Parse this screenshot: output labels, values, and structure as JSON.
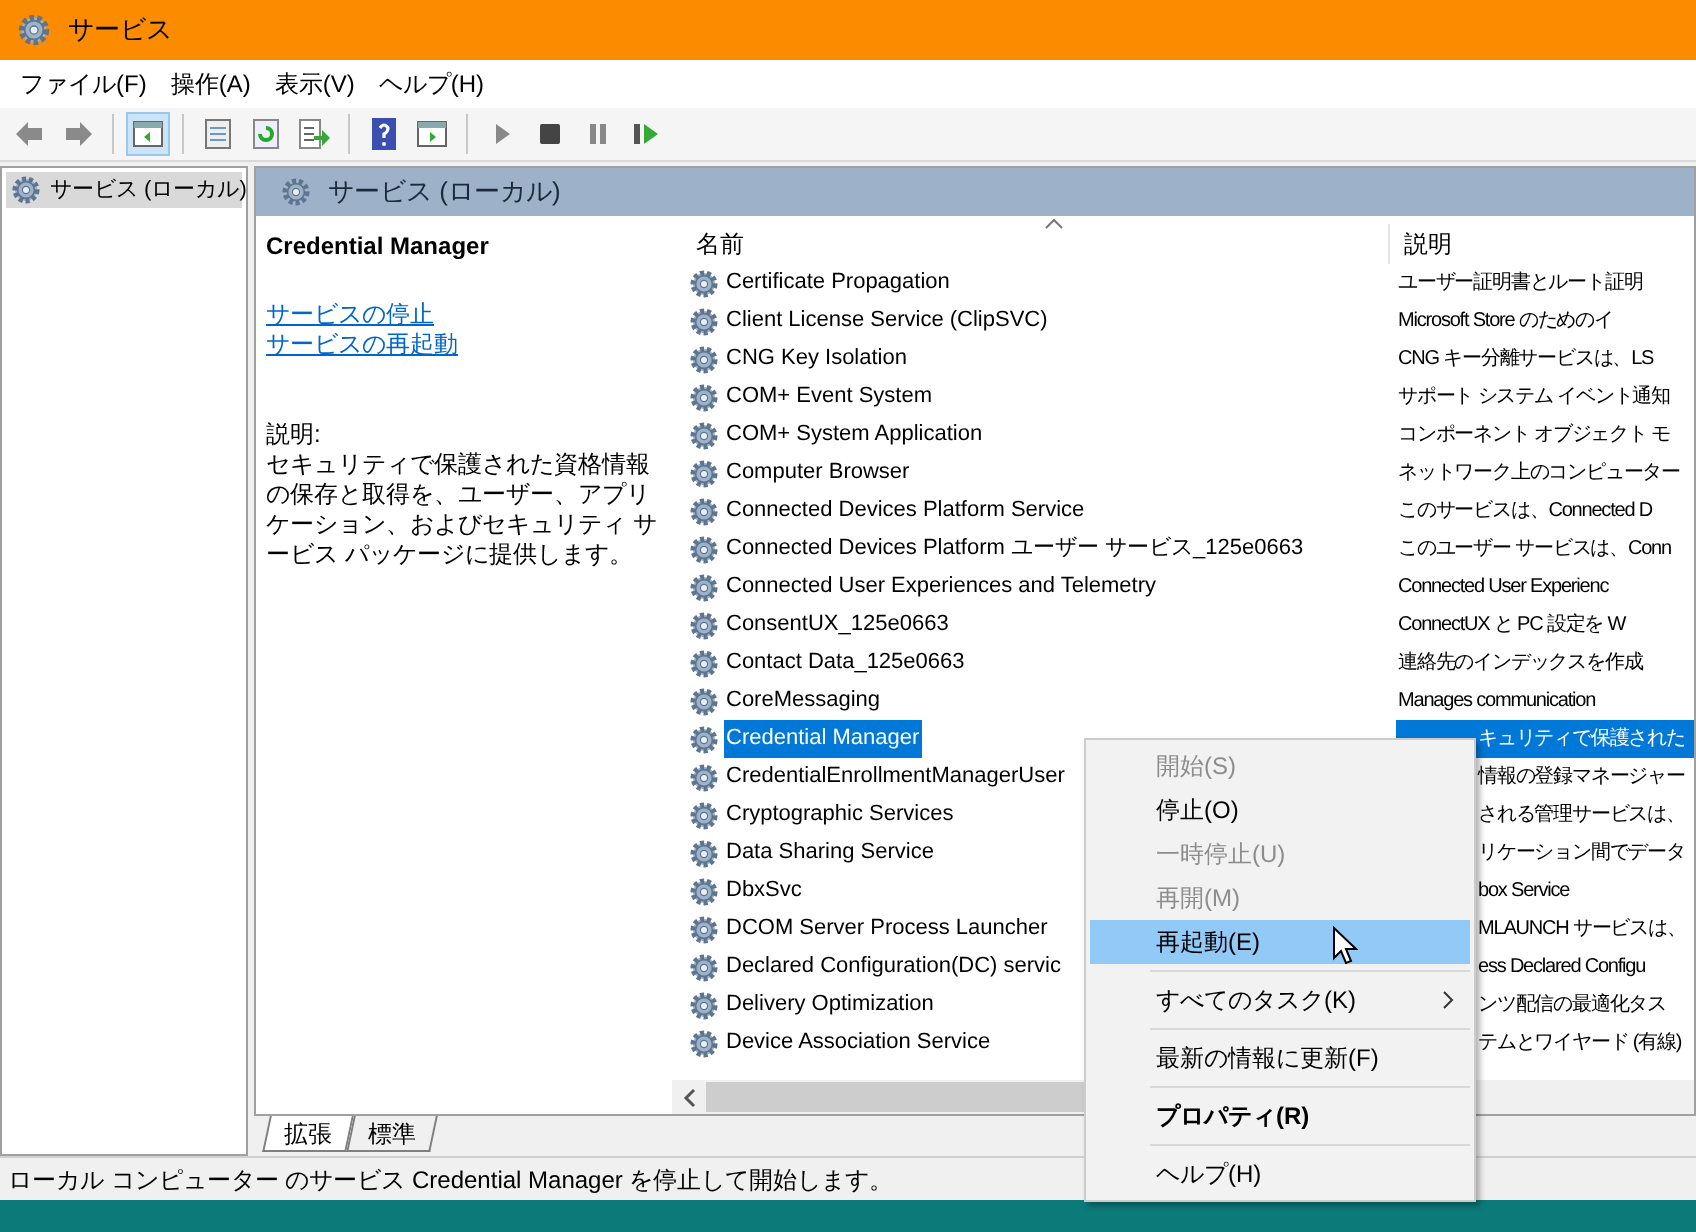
{
  "window": {
    "title": "サービス"
  },
  "menu": [
    "ファイル(F)",
    "操作(A)",
    "表示(V)",
    "ヘルプ(H)"
  ],
  "toolbar": [
    {
      "kind": "back"
    },
    {
      "kind": "forward"
    },
    {
      "kind": "sep"
    },
    {
      "kind": "tree",
      "selected": true
    },
    {
      "kind": "sep"
    },
    {
      "kind": "props"
    },
    {
      "kind": "refresh"
    },
    {
      "kind": "export"
    },
    {
      "kind": "sep"
    },
    {
      "kind": "help"
    },
    {
      "kind": "pane"
    },
    {
      "kind": "sep"
    },
    {
      "kind": "play"
    },
    {
      "kind": "stop"
    },
    {
      "kind": "pause"
    },
    {
      "kind": "resume"
    }
  ],
  "tree": [
    {
      "label": "サービス (ローカル)",
      "selected": true
    }
  ],
  "pane": {
    "title": "サービス (ローカル)",
    "details": {
      "name": "Credential Manager",
      "links": [
        "サービスの停止",
        "サービスの再起動"
      ],
      "desc_label": "説明:",
      "desc": "セキュリティで保護された資格情報の保存と取得を、ユーザー、アプリケーション、およびセキュリティ サービス パッケージに提供します。"
    },
    "columns": [
      "名前",
      "説明"
    ],
    "rows": [
      {
        "name": "Certificate Propagation",
        "desc": "ユーザー証明書とルート証明",
        "selected": false,
        "covered": false
      },
      {
        "name": "Client License Service (ClipSVC)",
        "desc": "Microsoft Store のためのイ",
        "selected": false,
        "covered": false
      },
      {
        "name": "CNG Key Isolation",
        "desc": "CNG キー分離サービスは、LS",
        "selected": false,
        "covered": false
      },
      {
        "name": "COM+ Event System",
        "desc": "サポート システム イベント通知",
        "selected": false,
        "covered": false
      },
      {
        "name": "COM+ System Application",
        "desc": "コンポーネント オブジェクト モ",
        "selected": false,
        "covered": false
      },
      {
        "name": "Computer Browser",
        "desc": "ネットワーク上のコンピューター",
        "selected": false,
        "covered": false
      },
      {
        "name": "Connected Devices Platform Service",
        "desc": "このサービスは、Connected D",
        "selected": false,
        "covered": false
      },
      {
        "name": "Connected Devices Platform ユーザー サービス_125e0663",
        "desc": "このユーザー サービスは、Conn",
        "selected": false,
        "covered": false
      },
      {
        "name": "Connected User Experiences and Telemetry",
        "desc": "Connected User Experienc",
        "selected": false,
        "covered": false
      },
      {
        "name": "ConsentUX_125e0663",
        "desc": "ConnectUX と PC 設定を W",
        "selected": false,
        "covered": false
      },
      {
        "name": "Contact Data_125e0663",
        "desc": "連絡先のインデックスを作成",
        "selected": false,
        "covered": false
      },
      {
        "name": "CoreMessaging",
        "desc": "Manages communication",
        "selected": false,
        "covered": false
      },
      {
        "name": "Credential Manager",
        "desc": "キュリティで保護された",
        "selected": true,
        "covered": true
      },
      {
        "name": "CredentialEnrollmentManagerUser",
        "desc": "情報の登録マネージャー",
        "selected": false,
        "covered": true
      },
      {
        "name": "Cryptographic Services",
        "desc": "される管理サービスは、",
        "selected": false,
        "covered": true
      },
      {
        "name": "Data Sharing Service",
        "desc": "リケーション間でデータ",
        "selected": false,
        "covered": true
      },
      {
        "name": "DbxSvc",
        "desc": "box Service",
        "selected": false,
        "covered": true
      },
      {
        "name": "DCOM Server Process Launcher",
        "desc": "MLAUNCH サービスは、",
        "selected": false,
        "covered": true
      },
      {
        "name": "Declared Configuration(DC) servic",
        "desc": "ess Declared Configu",
        "selected": false,
        "covered": true
      },
      {
        "name": "Delivery Optimization",
        "desc": "ンツ配信の最適化タス",
        "selected": false,
        "covered": true
      },
      {
        "name": "Device Association Service",
        "desc": "テムとワイヤード (有線)",
        "selected": false,
        "covered": true
      }
    ],
    "tabs": [
      {
        "label": "拡張",
        "selected": true
      },
      {
        "label": "標準",
        "selected": false
      }
    ]
  },
  "context_menu": [
    {
      "kind": "item",
      "label": "開始(S)",
      "disabled": true,
      "selected": false
    },
    {
      "kind": "item",
      "label": "停止(O)",
      "disabled": false,
      "selected": false
    },
    {
      "kind": "item",
      "label": "一時停止(U)",
      "disabled": true,
      "selected": false
    },
    {
      "kind": "item",
      "label": "再開(M)",
      "disabled": true,
      "selected": false
    },
    {
      "kind": "item",
      "label": "再起動(E)",
      "disabled": false,
      "selected": true
    },
    {
      "kind": "sep"
    },
    {
      "kind": "submenu",
      "label": "すべてのタスク(K)",
      "disabled": false,
      "selected": false
    },
    {
      "kind": "sep"
    },
    {
      "kind": "item",
      "label": "最新の情報に更新(F)",
      "disabled": false,
      "selected": false
    },
    {
      "kind": "sep"
    },
    {
      "kind": "bold",
      "label": "プロパティ(R)",
      "disabled": false,
      "selected": false
    },
    {
      "kind": "sep"
    },
    {
      "kind": "item",
      "label": "ヘルプ(H)",
      "disabled": false,
      "selected": false
    }
  ],
  "status_bar": "ローカル コンピューター のサービス Credential Manager を停止して開始します。"
}
